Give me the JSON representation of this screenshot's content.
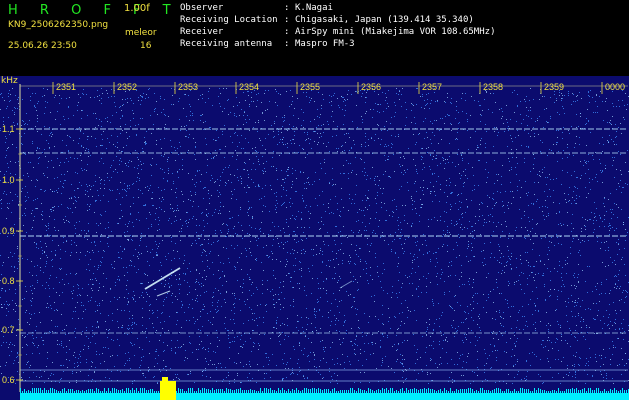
{
  "header": {
    "logo": "H R O F F T",
    "version": "1.00f",
    "filename": "KN9_2506262350.png",
    "datetime": "25.06.26 23:50",
    "counter_label": "meleor",
    "counter_value": "16",
    "info": [
      {
        "label": "Observer",
        "value": "K.Nagai"
      },
      {
        "label": "Receiving Location",
        "value": "Chigasaki, Japan (139.414 35.340)"
      },
      {
        "label": "Receiver",
        "value": "AirSpy mini (Miakejima VOR 108.65MHz)"
      },
      {
        "label": "Receiving antenna",
        "value": "Maspro FM-3"
      }
    ]
  },
  "axis": {
    "unit": "kHz",
    "time_ticks": [
      "2351",
      "2352",
      "2353",
      "2354",
      "2355",
      "2356",
      "2357",
      "2358",
      "2359",
      "0000"
    ],
    "freq_ticks": [
      "1.1",
      "1.0",
      "0.9",
      "0.8",
      "0.7",
      "0.6"
    ]
  },
  "colors": {
    "background": "#0b0b6e",
    "noise": "#3f8fff",
    "tick_label": "#f0e040",
    "spectrum": "#00f0ff",
    "burst": "#ffff00"
  }
}
